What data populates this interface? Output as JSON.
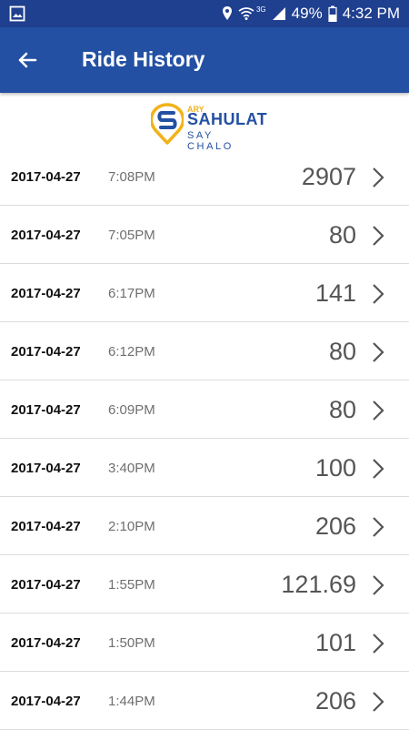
{
  "status_bar": {
    "battery": "49%",
    "time": "4:32 PM",
    "network": "3G",
    "icons": [
      "image-icon",
      "location-icon",
      "wifi-icon",
      "signal-icon",
      "battery-icon"
    ]
  },
  "header": {
    "title": "Ride History",
    "back_icon": "back-arrow-icon"
  },
  "logo": {
    "prefix": "ARY",
    "name": "SAHULAT",
    "tagline": "SAY CHALO"
  },
  "rides": [
    {
      "date": "2017-04-27",
      "time": "7:08PM",
      "amount": "2907"
    },
    {
      "date": "2017-04-27",
      "time": "7:05PM",
      "amount": "80"
    },
    {
      "date": "2017-04-27",
      "time": "6:17PM",
      "amount": "141"
    },
    {
      "date": "2017-04-27",
      "time": "6:12PM",
      "amount": "80"
    },
    {
      "date": "2017-04-27",
      "time": "6:09PM",
      "amount": "80"
    },
    {
      "date": "2017-04-27",
      "time": "3:40PM",
      "amount": "100"
    },
    {
      "date": "2017-04-27",
      "time": "2:10PM",
      "amount": "206"
    },
    {
      "date": "2017-04-27",
      "time": "1:55PM",
      "amount": "121.69"
    },
    {
      "date": "2017-04-27",
      "time": "1:50PM",
      "amount": "101"
    },
    {
      "date": "2017-04-27",
      "time": "1:44PM",
      "amount": "206"
    }
  ],
  "colors": {
    "appbar": "#2350a3",
    "statusbar": "#1f3f8f",
    "logo_yellow": "#f1b21a"
  }
}
